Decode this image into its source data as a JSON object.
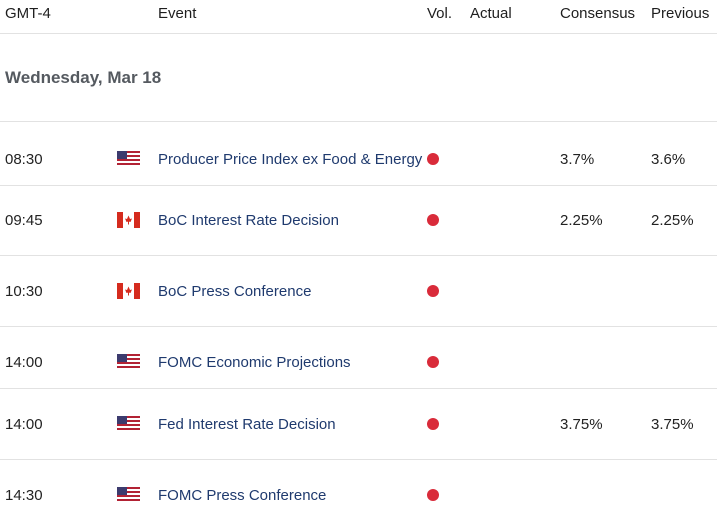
{
  "header": {
    "timezone": "GMT-4",
    "event": "Event",
    "vol": "Vol.",
    "actual": "Actual",
    "consensus": "Consensus",
    "previous": "Previous"
  },
  "day_label": "Wednesday, Mar 18",
  "colors": {
    "event_text": "#1f3a6e",
    "volatility_dot": "#d92b3a",
    "divider": "#e2e2e2"
  },
  "rows": [
    {
      "time": "08:30",
      "flag": "us-flag-icon",
      "event": "Producer Price Index ex Food & Energy",
      "volatility": "high",
      "actual": "",
      "consensus": "3.7%",
      "previous": "3.6%"
    },
    {
      "time": "09:45",
      "flag": "ca-flag-icon",
      "event": "BoC Interest Rate Decision",
      "volatility": "high",
      "actual": "",
      "consensus": "2.25%",
      "previous": "2.25%"
    },
    {
      "time": "10:30",
      "flag": "ca-flag-icon",
      "event": "BoC Press Conference",
      "volatility": "high",
      "actual": "",
      "consensus": "",
      "previous": ""
    },
    {
      "time": "14:00",
      "flag": "us-flag-icon",
      "event": "FOMC Economic Projections",
      "volatility": "high",
      "actual": "",
      "consensus": "",
      "previous": ""
    },
    {
      "time": "14:00",
      "flag": "us-flag-icon",
      "event": "Fed Interest Rate Decision",
      "volatility": "high",
      "actual": "",
      "consensus": "3.75%",
      "previous": "3.75%"
    },
    {
      "time": "14:30",
      "flag": "us-flag-icon",
      "event": "FOMC Press Conference",
      "volatility": "high",
      "actual": "",
      "consensus": "",
      "previous": ""
    }
  ]
}
